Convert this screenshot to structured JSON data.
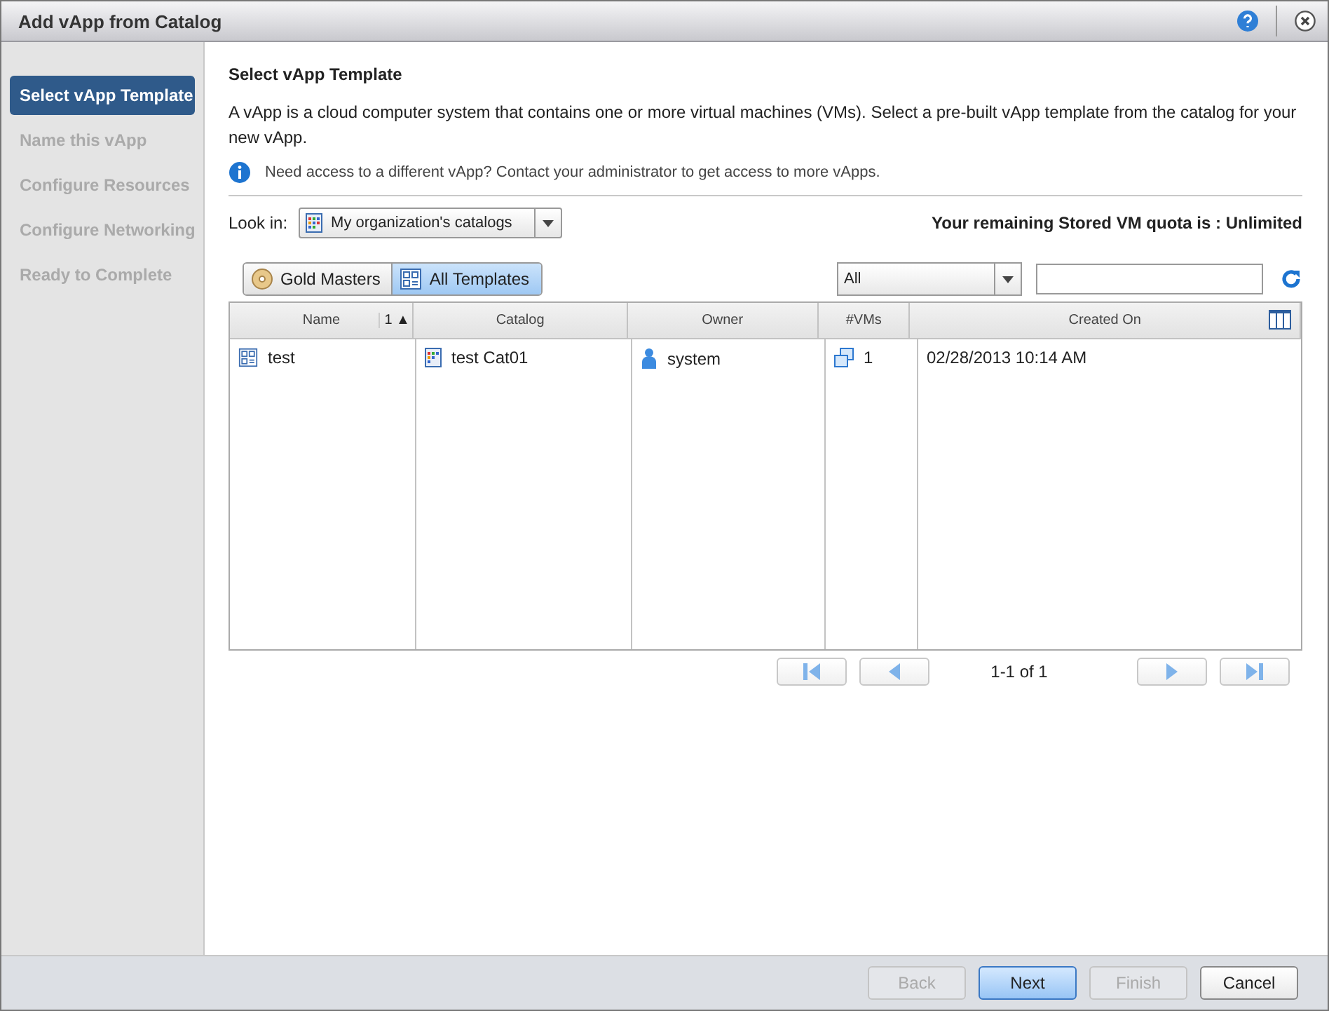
{
  "window": {
    "title": "Add vApp from Catalog"
  },
  "steps": [
    {
      "label": "Select vApp Template",
      "selected": true
    },
    {
      "label": "Name this vApp",
      "selected": false
    },
    {
      "label": "Configure Resources",
      "selected": false
    },
    {
      "label": "Configure Networking",
      "selected": false
    },
    {
      "label": "Ready to Complete",
      "selected": false
    }
  ],
  "heading": "Select vApp Template",
  "description": "A vApp is a cloud computer system that contains one or more virtual machines (VMs). Select a pre-built vApp template from the catalog for your new vApp.",
  "info": "Need access to a different vApp? Contact your administrator to get access to more vApps.",
  "look_in": {
    "label": "Look in:",
    "value": "My organization's catalogs"
  },
  "quota": "Your remaining Stored VM quota is : Unlimited",
  "filters": [
    {
      "label": "Gold Masters",
      "kind": "gold",
      "selected": false
    },
    {
      "label": "All Templates",
      "kind": "templates",
      "selected": true
    }
  ],
  "filter_select": {
    "value": "All"
  },
  "table": {
    "columns": [
      {
        "label": "Name",
        "sort": "1 ▲"
      },
      {
        "label": "Catalog"
      },
      {
        "label": "Owner"
      },
      {
        "label": "#VMs"
      },
      {
        "label": "Created On"
      }
    ],
    "rows": [
      {
        "name": "test",
        "catalog": "test Cat01",
        "owner": "system",
        "vms": "1",
        "created": "02/28/2013 10:14 AM"
      }
    ]
  },
  "pagination": "1-1 of 1",
  "buttons": [
    {
      "label": "Back",
      "disabled": true,
      "primary": false
    },
    {
      "label": "Next",
      "disabled": false,
      "primary": true
    },
    {
      "label": "Finish",
      "disabled": true,
      "primary": false
    },
    {
      "label": "Cancel",
      "disabled": false,
      "primary": false
    }
  ]
}
